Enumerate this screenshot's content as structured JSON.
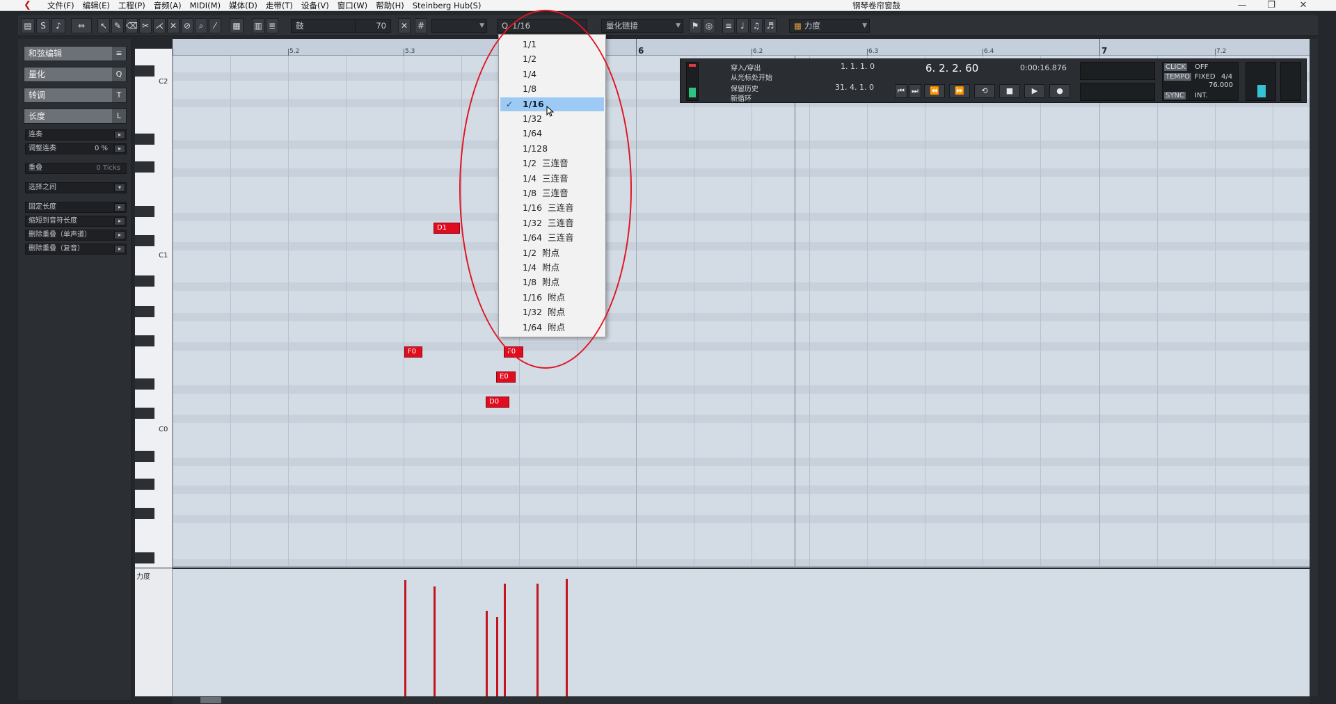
{
  "titlebar": {
    "menu": [
      "文件(F)",
      "编辑(E)",
      "工程(P)",
      "音频(A)",
      "MIDI(M)",
      "媒体(D)",
      "走带(T)",
      "设备(V)",
      "窗口(W)",
      "帮助(H)",
      "Steinberg Hub(S)"
    ],
    "window_title": "钢琴卷帘窗鼓",
    "min": "—",
    "restore": "❐",
    "close": "✕"
  },
  "toolbar": {
    "drum_field": "鼓",
    "velocity_value": "70",
    "quantize_value": "1/16",
    "quantize_link": "量化链接",
    "velocity_lane": "力度"
  },
  "inspector": {
    "sections": [
      "和弦编辑",
      "量化",
      "转调",
      "长度"
    ],
    "section_keys": [
      "≡",
      "Q",
      "T",
      "L"
    ],
    "rows": [
      "连奏",
      "调整连奏",
      "重叠",
      "选择之间",
      "固定长度",
      "缩短到音符长度",
      "删除重叠（单声道）",
      "删除重叠（复音）"
    ],
    "legato_adjust_value": "0 %",
    "overlap_value": "0 Ticks"
  },
  "keyboard": {
    "labels": [
      "C2",
      "C1",
      "C0"
    ],
    "velocity_lane_label": "力度"
  },
  "ruler": {
    "bar_labels": [
      "6",
      "7"
    ],
    "beat_labels": [
      "5.2",
      "5.3",
      "6.2",
      "6.3",
      "6.4",
      "7.2"
    ]
  },
  "notes": [
    {
      "pitch": "D1",
      "label": "D1"
    },
    {
      "pitch": "F0",
      "label": "F0"
    },
    {
      "pitch": "F0",
      "label": "F0"
    },
    {
      "pitch": "E0",
      "label": "E0"
    },
    {
      "pitch": "D0",
      "label": "D0"
    }
  ],
  "velocity": {
    "levels": [
      0.95,
      0.9,
      0.7,
      0.65,
      0.92,
      0.92,
      0.96
    ]
  },
  "transport": {
    "punch_labels": [
      "穿入/穿出",
      "从光标处开始",
      "保留历史",
      "新循环"
    ],
    "left_locator": "1. 1. 1.  0",
    "right_locator": "31. 4. 1.  0",
    "position": "6. 2. 2. 60",
    "time": "0:00:16.876",
    "click_label": "CLICK",
    "click_state": "OFF",
    "tempo_label": "TEMPO",
    "tempo_mode": "FIXED",
    "signature": "4/4",
    "tempo_value": "76.000",
    "sync_label": "SYNC",
    "sync_state": "INT.",
    "buttons": [
      "⏮",
      "⏭",
      "⏪",
      "⏩",
      "⟲",
      "■",
      "▶",
      "●"
    ]
  },
  "quantize_dropdown": {
    "items": [
      {
        "label": "1/1",
        "suffix": ""
      },
      {
        "label": "1/2",
        "suffix": ""
      },
      {
        "label": "1/4",
        "suffix": ""
      },
      {
        "label": "1/8",
        "suffix": ""
      },
      {
        "label": "1/16",
        "suffix": ""
      },
      {
        "label": "1/32",
        "suffix": ""
      },
      {
        "label": "1/64",
        "suffix": ""
      },
      {
        "label": "1/128",
        "suffix": ""
      },
      {
        "label": "1/2",
        "suffix": "三连音"
      },
      {
        "label": "1/4",
        "suffix": "三连音"
      },
      {
        "label": "1/8",
        "suffix": "三连音"
      },
      {
        "label": "1/16",
        "suffix": "三连音"
      },
      {
        "label": "1/32",
        "suffix": "三连音"
      },
      {
        "label": "1/64",
        "suffix": "三连音"
      },
      {
        "label": "1/2",
        "suffix": "附点"
      },
      {
        "label": "1/4",
        "suffix": "附点"
      },
      {
        "label": "1/8",
        "suffix": "附点"
      },
      {
        "label": "1/16",
        "suffix": "附点"
      },
      {
        "label": "1/32",
        "suffix": "附点"
      },
      {
        "label": "1/64",
        "suffix": "附点"
      }
    ],
    "selected_index": 4,
    "check": "✓"
  },
  "colors": {
    "note": "#e00d1f",
    "highlight": "#e11522",
    "selected_item": "#9ccaf4"
  }
}
